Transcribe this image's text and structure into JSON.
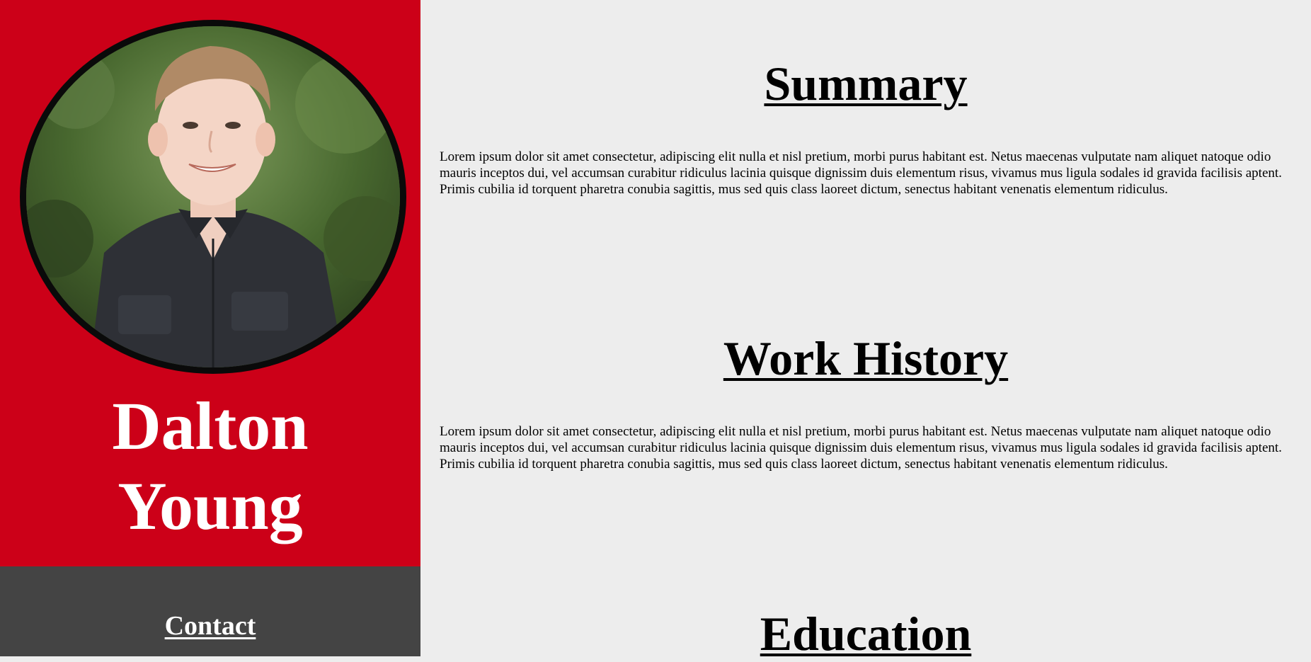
{
  "sidebar": {
    "name_first": "Dalton",
    "name_last": "Young",
    "contact_heading": "Contact",
    "accent_color": "#cc0018",
    "footer_color": "#444444"
  },
  "main": {
    "background_color": "#ededed",
    "sections": [
      {
        "title": "Summary",
        "body": "Lorem ipsum dolor sit amet consectetur, adipiscing elit nulla et nisl pretium, morbi purus habitant est. Netus maecenas vulputate nam aliquet natoque odio mauris inceptos dui, vel accumsan curabitur ridiculus lacinia quisque dignissim duis elementum risus, vivamus mus ligula sodales id gravida facilisis aptent. Primis cubilia id torquent pharetra conubia sagittis, mus sed quis class laoreet dictum, senectus habitant venenatis elementum ridiculus."
      },
      {
        "title": "Work History",
        "body": "Lorem ipsum dolor sit amet consectetur, adipiscing elit nulla et nisl pretium, morbi purus habitant est. Netus maecenas vulputate nam aliquet natoque odio mauris inceptos dui, vel accumsan curabitur ridiculus lacinia quisque dignissim duis elementum risus, vivamus mus ligula sodales id gravida facilisis aptent. Primis cubilia id torquent pharetra conubia sagittis, mus sed quis class laoreet dictum, senectus habitant venenatis elementum ridiculus."
      },
      {
        "title": "Education"
      }
    ]
  }
}
